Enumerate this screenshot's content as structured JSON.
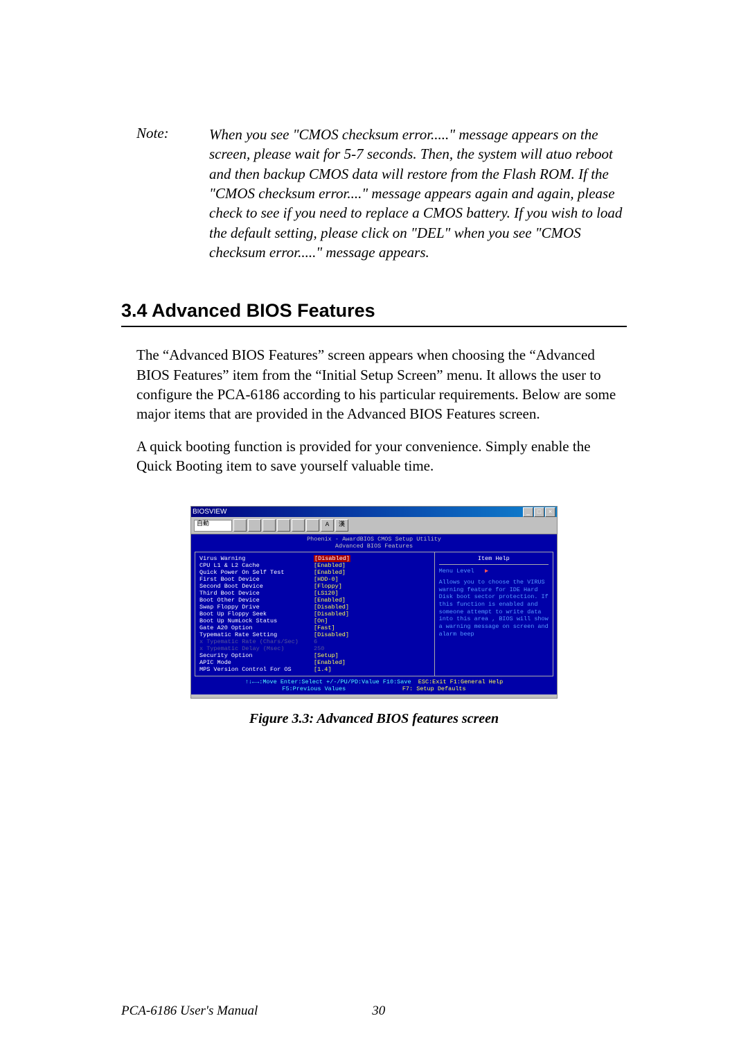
{
  "note": {
    "label": "Note:",
    "text": "When you see \"CMOS checksum error.....\" message appears on the screen, please wait for 5-7 seconds. Then, the system will atuo reboot and then backup CMOS data will restore from the Flash ROM.    If the \"CMOS checksum error....\" message appears again and again, please check to see if you need to replace a CMOS battery. If you wish to load the default setting, please click on \"DEL\" when you see \"CMOS checksum error.....\" message appears."
  },
  "section": {
    "number_title": "3.4  Advanced BIOS Features"
  },
  "paragraphs": {
    "p1": "The “Advanced BIOS Features” screen appears when choosing the “Advanced BIOS Features” item from the “Initial Setup Screen” menu. It allows the user to configure the PCA-6186 according to his particular requirements. Below are some major items that are provided in the Advanced BIOS Features screen.",
    "p2": "A quick booting function is provided for your convenience. Simply enable the Quick Booting item to save yourself valuable time."
  },
  "bios": {
    "window_title": "BIOSVIEW",
    "toolbar_zoom": "自動",
    "tb_btn_a": "A",
    "tb_btn_kan": "漢",
    "header_line1": "Phoenix - AwardBIOS CMOS Setup Utility",
    "header_line2": "Advanced BIOS Features",
    "rows": [
      {
        "k": "Virus Warning",
        "v": "[Disabled]",
        "hl": true
      },
      {
        "k": "CPU L1 & L2 Cache",
        "v": "[Enabled]"
      },
      {
        "k": "Quick Power On Self Test",
        "v": "[Enabled]"
      },
      {
        "k": "First Boot Device",
        "v": "[HDD-0]"
      },
      {
        "k": "Second Boot Device",
        "v": "[Floppy]"
      },
      {
        "k": "Third Boot Device",
        "v": "[LS120]"
      },
      {
        "k": "Boot Other Device",
        "v": "[Enabled]"
      },
      {
        "k": "Swap Floppy Drive",
        "v": "[Disabled]"
      },
      {
        "k": "Boot Up Floppy Seek",
        "v": "[Disabled]"
      },
      {
        "k": "Boot Up NumLock Status",
        "v": "[On]"
      },
      {
        "k": "Gate A20 Option",
        "v": "[Fast]"
      },
      {
        "k": "Typematic Rate Setting",
        "v": "[Disabled]"
      },
      {
        "k": "x Typematic Rate (Chars/Sec)",
        "v": "6",
        "dim": true
      },
      {
        "k": "x Typematic Delay (Msec)",
        "v": "250",
        "dim": true
      },
      {
        "k": "Security Option",
        "v": "[Setup]"
      },
      {
        "k": "APIC Mode",
        "v": "[Enabled]"
      },
      {
        "k": "MPS Version Control For OS",
        "v": "[1.4]"
      }
    ],
    "right": {
      "title": "Item Help",
      "menu_level": "Menu Level",
      "arrow": "▶",
      "body": "Allows you to choose the VIRUS warning feature for IDE Hard Disk boot sector protection. If this function is enabled and someone attempt to write data into this area ,  BIOS will show a warning message on screen and alarm beep"
    },
    "footer": {
      "line1a": "↑↓←→:Move  Enter:Select  +/-/PU/PD:Value  F10:Save",
      "line1b": "ESC:Exit  F1:General Help",
      "line2a": "F5:Previous Values",
      "line2b": "F7: Setup Defaults"
    }
  },
  "caption": "Figure 3.3: Advanced BIOS features screen",
  "footer": {
    "left": "PCA-6186 User's Manual",
    "page": "30"
  }
}
